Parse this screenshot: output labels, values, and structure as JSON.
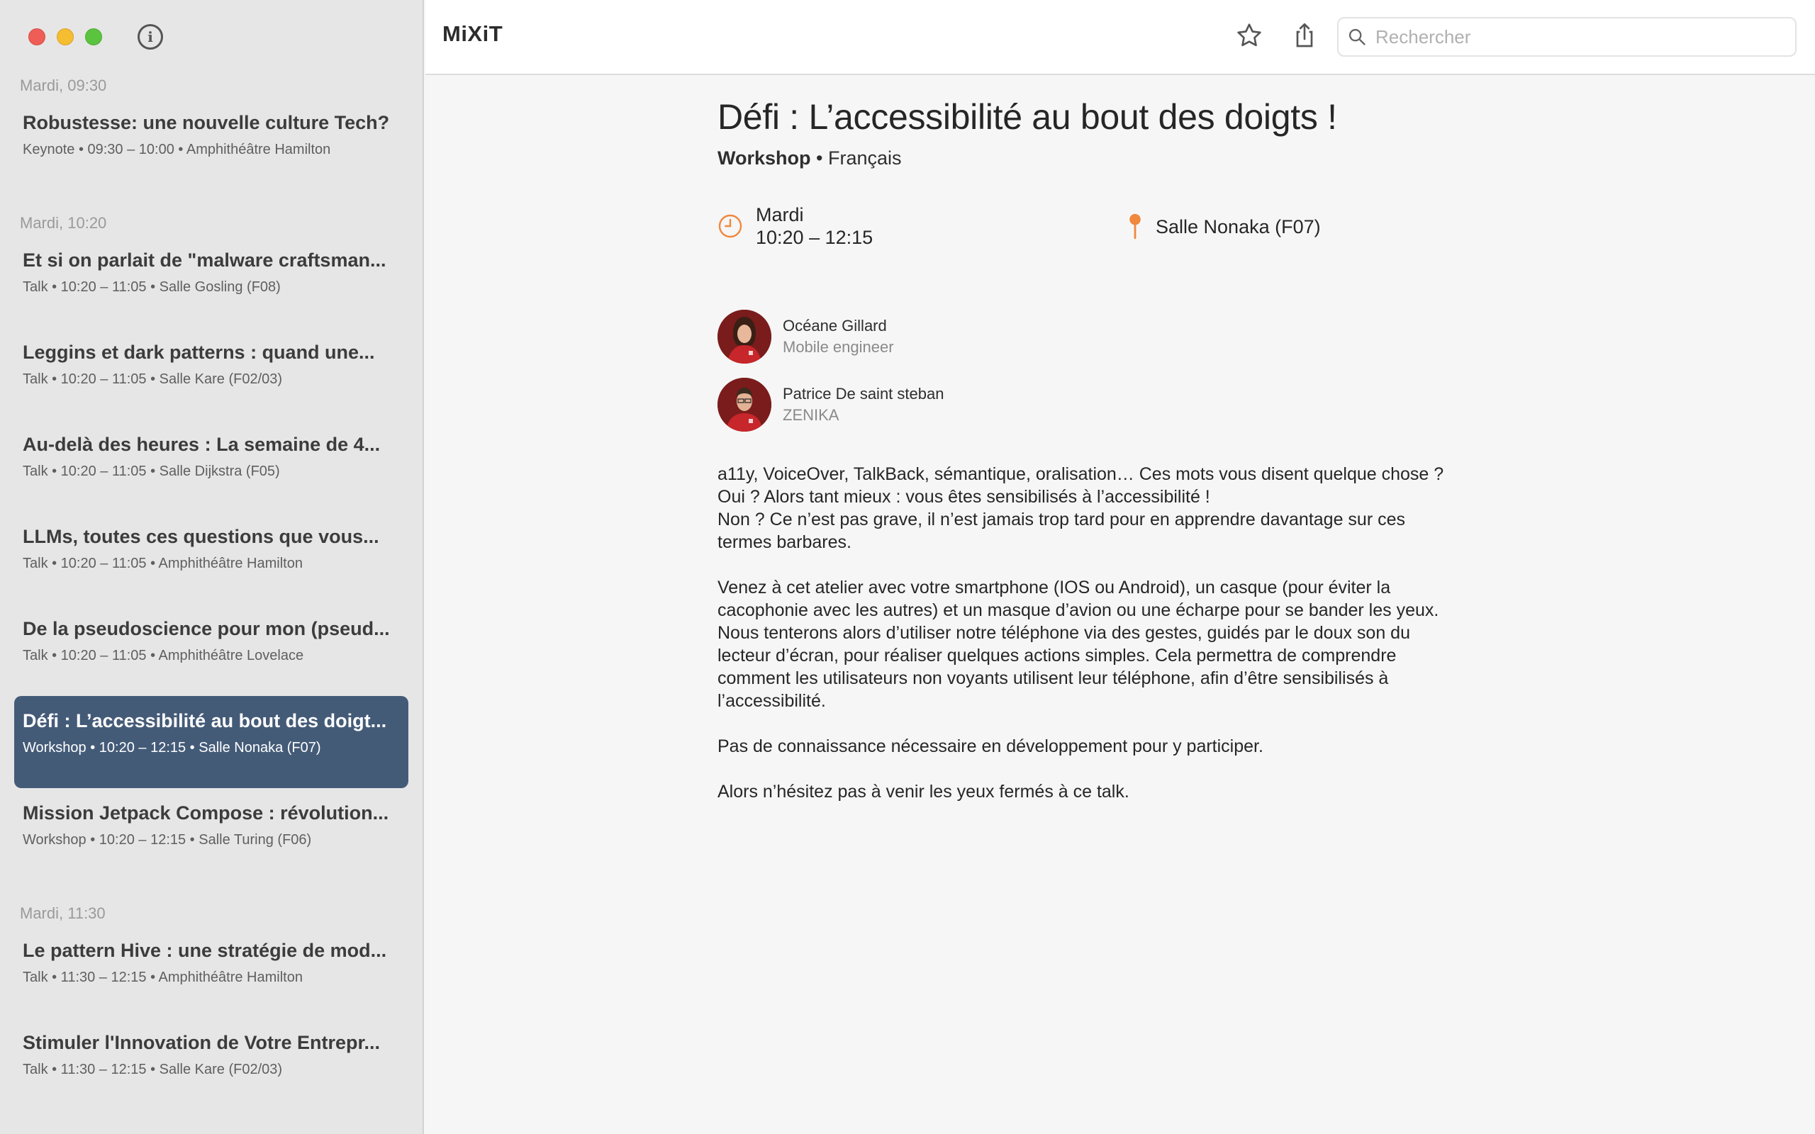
{
  "app": {
    "title": "MiXiT"
  },
  "search": {
    "placeholder": "Rechercher"
  },
  "sidebar": {
    "sections": [
      {
        "header": "Mardi, 09:30",
        "sessions": [
          {
            "title": "Robustesse: une nouvelle culture Tech?",
            "meta": "Keynote • 09:30 – 10:00 • Amphithéâtre Hamilton"
          }
        ]
      },
      {
        "header": "Mardi, 10:20",
        "sessions": [
          {
            "title": "Et si on parlait de \"malware craftsman...",
            "meta": "Talk • 10:20 – 11:05 • Salle Gosling (F08)"
          },
          {
            "title": "Leggins et dark patterns : quand une...",
            "meta": "Talk • 10:20 – 11:05 • Salle Kare (F02/03)"
          },
          {
            "title": "Au-delà des heures : La semaine de 4...",
            "meta": "Talk • 10:20 – 11:05 • Salle Dijkstra (F05)"
          },
          {
            "title": "LLMs, toutes ces questions que vous...",
            "meta": "Talk • 10:20 – 11:05 • Amphithéâtre Hamilton"
          },
          {
            "title": "De la pseudoscience pour mon (pseud...",
            "meta": "Talk • 10:20 – 11:05 • Amphithéâtre Lovelace"
          },
          {
            "title": "Défi : L’accessibilité au bout des doigt...",
            "meta": "Workshop • 10:20 – 12:15 • Salle Nonaka (F07)",
            "selected": true
          },
          {
            "title": "Mission Jetpack Compose : révolution...",
            "meta": "Workshop • 10:20 – 12:15 • Salle Turing (F06)"
          }
        ]
      },
      {
        "header": "Mardi, 11:30",
        "sessions": [
          {
            "title": "Le pattern Hive : une stratégie de mod...",
            "meta": "Talk • 11:30 – 12:15 • Amphithéâtre Hamilton"
          },
          {
            "title": "Stimuler l'Innovation de Votre Entrepr...",
            "meta": "Talk • 11:30 – 12:15 • Salle Kare (F02/03)"
          }
        ]
      }
    ]
  },
  "detail": {
    "title": "Défi : L’accessibilité au bout des doigts !",
    "format": "Workshop",
    "separator": "•",
    "language": "Français",
    "day": "Mardi",
    "time": "10:20 – 12:15",
    "room": "Salle Nonaka (F07)",
    "speakers": [
      {
        "name": "Océane Gillard",
        "role": "Mobile engineer"
      },
      {
        "name": "Patrice De saint steban",
        "role": "ZENIKA"
      }
    ],
    "description": [
      [
        "a11y, VoiceOver, TalkBack, sémantique, oralisation… Ces mots vous disent quelque chose ?",
        "Oui ? Alors tant mieux : vous êtes sensibilisés à l’accessibilité !",
        "Non ? Ce n’est pas grave, il n’est jamais trop tard pour en apprendre davantage sur ces",
        "termes barbares."
      ],
      [
        "Venez à cet atelier avec votre smartphone (IOS ou Android), un casque (pour éviter la",
        "cacophonie avec les autres) et un masque d’avion ou une écharpe pour se bander les yeux.",
        "Nous tenterons alors d’utiliser notre téléphone via des gestes, guidés par le doux son du",
        "lecteur d’écran, pour réaliser quelques actions simples. Cela permettra de comprendre",
        "comment les utilisateurs non voyants utilisent leur téléphone, afin d’être sensibilisés à",
        "l’accessibilité."
      ],
      [
        "Pas de connaissance nécessaire en développement pour y participer."
      ],
      [
        "Alors n’hésitez pas à venir les yeux fermés à ce talk."
      ]
    ]
  },
  "colors": {
    "accent": "#f0883e",
    "selection": "#445b78",
    "sidebar_bg": "#e6e6e6"
  },
  "icons": {
    "info": "info-circle-icon",
    "favorite": "star-icon",
    "share": "share-icon",
    "search": "search-icon",
    "time": "clock-icon",
    "location": "map-pin-icon"
  }
}
